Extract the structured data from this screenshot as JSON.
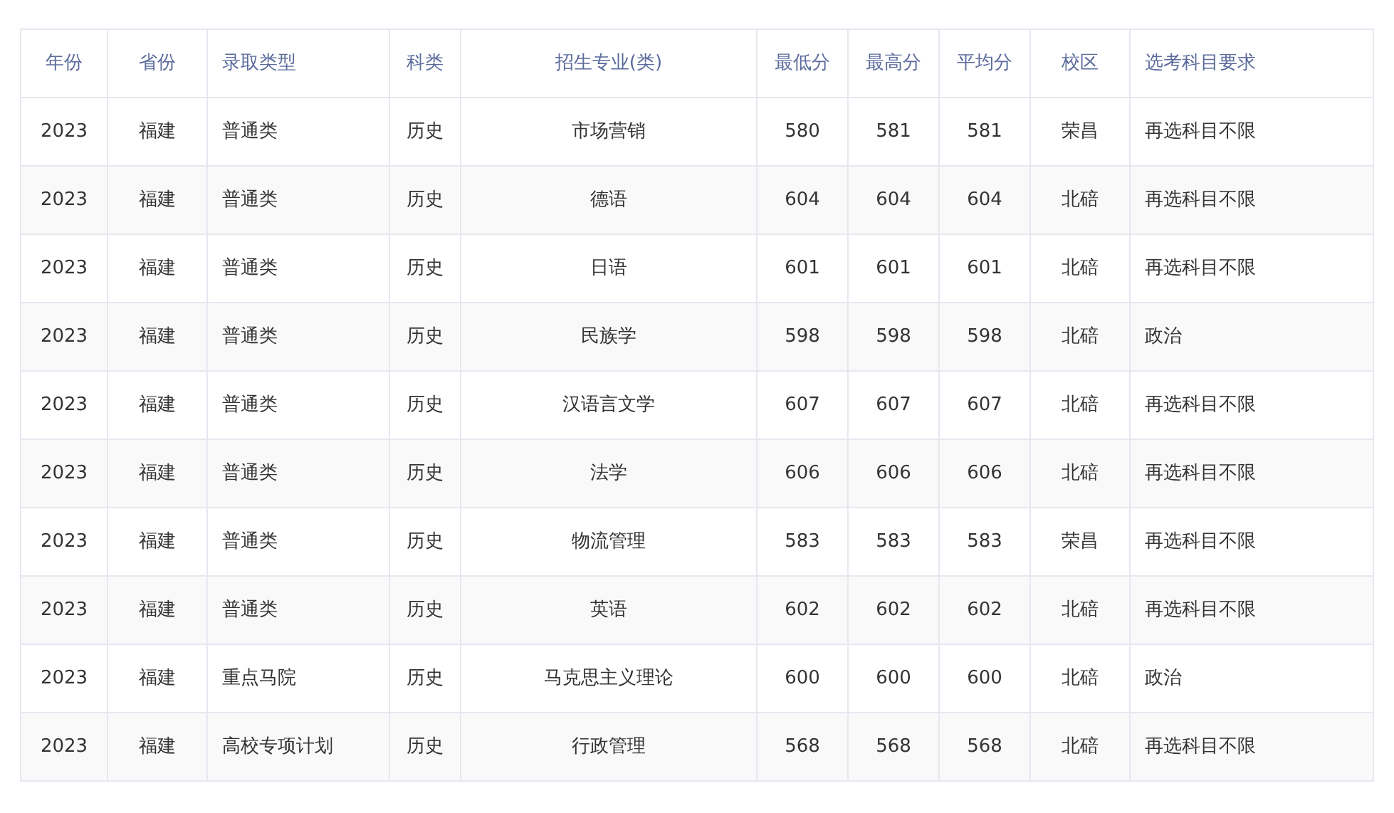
{
  "table": {
    "columns": [
      "年份",
      "省份",
      "录取类型",
      "科类",
      "招生专业(类)",
      "最低分",
      "最高分",
      "平均分",
      "校区",
      "选考科目要求"
    ],
    "rows": [
      [
        "2023",
        "福建",
        "普通类",
        "历史",
        "市场营销",
        "580",
        "581",
        "581",
        "荣昌",
        "再选科目不限"
      ],
      [
        "2023",
        "福建",
        "普通类",
        "历史",
        "德语",
        "604",
        "604",
        "604",
        "北碚",
        "再选科目不限"
      ],
      [
        "2023",
        "福建",
        "普通类",
        "历史",
        "日语",
        "601",
        "601",
        "601",
        "北碚",
        "再选科目不限"
      ],
      [
        "2023",
        "福建",
        "普通类",
        "历史",
        "民族学",
        "598",
        "598",
        "598",
        "北碚",
        "政治"
      ],
      [
        "2023",
        "福建",
        "普通类",
        "历史",
        "汉语言文学",
        "607",
        "607",
        "607",
        "北碚",
        "再选科目不限"
      ],
      [
        "2023",
        "福建",
        "普通类",
        "历史",
        "法学",
        "606",
        "606",
        "606",
        "北碚",
        "再选科目不限"
      ],
      [
        "2023",
        "福建",
        "普通类",
        "历史",
        "物流管理",
        "583",
        "583",
        "583",
        "荣昌",
        "再选科目不限"
      ],
      [
        "2023",
        "福建",
        "普通类",
        "历史",
        "英语",
        "602",
        "602",
        "602",
        "北碚",
        "再选科目不限"
      ],
      [
        "2023",
        "福建",
        "重点马院",
        "历史",
        "马克思主义理论",
        "600",
        "600",
        "600",
        "北碚",
        "政治"
      ],
      [
        "2023",
        "福建",
        "高校专项计划",
        "历史",
        "行政管理",
        "568",
        "568",
        "568",
        "北碚",
        "再选科目不限"
      ]
    ]
  }
}
